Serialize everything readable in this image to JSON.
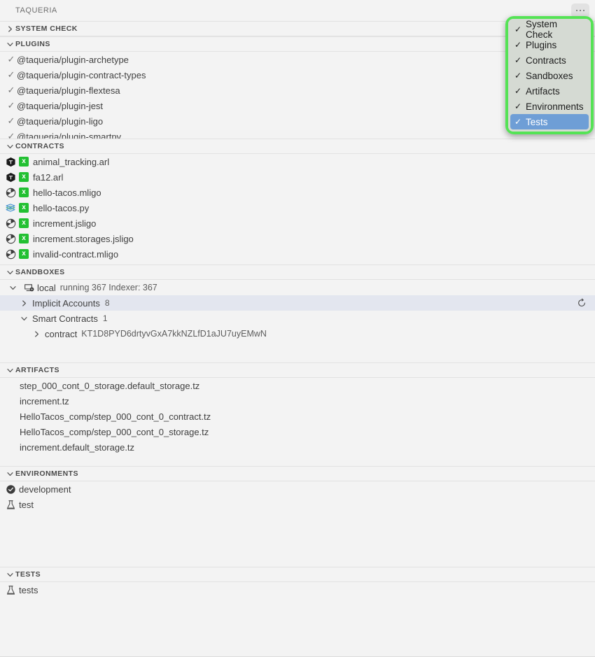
{
  "titlebar": {
    "title": "TAQUERIA",
    "more_button": "more-actions"
  },
  "sections": {
    "system_check": {
      "title": "SYSTEM CHECK",
      "expanded": false
    },
    "plugins": {
      "title": "PLUGINS",
      "expanded": true,
      "items": [
        {
          "label": "@taqueria/plugin-archetype",
          "check": "✓"
        },
        {
          "label": "@taqueria/plugin-contract-types",
          "check": "✓"
        },
        {
          "label": "@taqueria/plugin-flextesa",
          "check": "✓"
        },
        {
          "label": "@taqueria/plugin-jest",
          "check": "✓"
        },
        {
          "label": "@taqueria/plugin-ligo",
          "check": "✓"
        },
        {
          "label": "@taqueria/plugin-smartpy",
          "check": "✓"
        }
      ]
    },
    "contracts": {
      "title": "CONTRACTS",
      "expanded": true,
      "items": [
        {
          "label": "animal_tracking.arl",
          "icon": "archetype-cube-icon",
          "badge": "x"
        },
        {
          "label": "fa12.arl",
          "icon": "archetype-cube-icon",
          "badge": "x"
        },
        {
          "label": "hello-tacos.mligo",
          "icon": "ligo-circle-icon",
          "badge": "x"
        },
        {
          "label": "hello-tacos.py",
          "icon": "smartpy-hexagon-icon",
          "badge": "x"
        },
        {
          "label": "increment.jsligo",
          "icon": "ligo-circle-icon",
          "badge": "x"
        },
        {
          "label": "increment.storages.jsligo",
          "icon": "ligo-circle-icon",
          "badge": "x"
        },
        {
          "label": "invalid-contract.mligo",
          "icon": "ligo-circle-icon",
          "badge": "x"
        }
      ]
    },
    "sandboxes": {
      "title": "SANDBOXES",
      "expanded": true,
      "sandbox": {
        "name": "local",
        "status": "running 367 Indexer: 367",
        "expanded": true
      },
      "implicit_accounts": {
        "label": "Implicit Accounts",
        "count": "8",
        "expanded": false,
        "selected": true,
        "refresh": "refresh"
      },
      "smart_contracts": {
        "label": "Smart Contracts",
        "count": "1",
        "expanded": true,
        "children": [
          {
            "label": "contract",
            "address": "KT1D8PYD6drtyvGxA7kkNZLfD1aJU7uyEMwN",
            "expanded": false
          }
        ]
      }
    },
    "artifacts": {
      "title": "ARTIFACTS",
      "expanded": true,
      "items": [
        {
          "label": "step_000_cont_0_storage.default_storage.tz"
        },
        {
          "label": "increment.tz"
        },
        {
          "label": "HelloTacos_comp/step_000_cont_0_contract.tz"
        },
        {
          "label": "HelloTacos_comp/step_000_cont_0_storage.tz"
        },
        {
          "label": "increment.default_storage.tz"
        }
      ]
    },
    "environments": {
      "title": "ENVIRONMENTS",
      "expanded": true,
      "items": [
        {
          "label": "development",
          "icon": "check-circle-icon"
        },
        {
          "label": "test",
          "icon": "beaker-icon"
        }
      ]
    },
    "tests": {
      "title": "TESTS",
      "expanded": true,
      "items": [
        {
          "label": "tests",
          "icon": "beaker-icon"
        }
      ]
    }
  },
  "menu": {
    "highlighted": true,
    "items": [
      {
        "label": "System Check",
        "checked": true,
        "selected": false
      },
      {
        "label": "Plugins",
        "checked": true,
        "selected": false
      },
      {
        "label": "Contracts",
        "checked": true,
        "selected": false
      },
      {
        "label": "Sandboxes",
        "checked": true,
        "selected": false
      },
      {
        "label": "Artifacts",
        "checked": true,
        "selected": false
      },
      {
        "label": "Environments",
        "checked": true,
        "selected": false
      },
      {
        "label": "Tests",
        "checked": true,
        "selected": true
      }
    ],
    "check_glyph": "✓"
  },
  "colors": {
    "highlight_border": "#55e355",
    "menu_bg": "#d5dad3",
    "selection_blue": "#6e9ed6",
    "badge_green": "#22c032",
    "row_selected": "#e3e6ef"
  }
}
